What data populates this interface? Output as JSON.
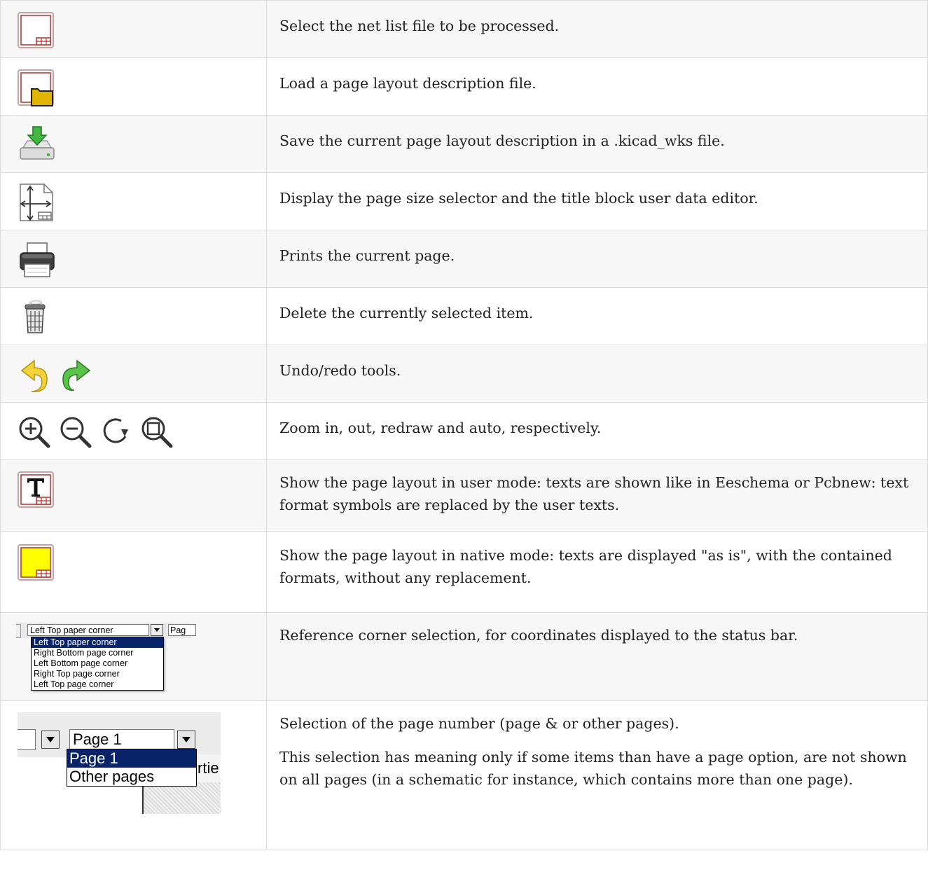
{
  "rows": [
    {
      "icon": "netlist-file-icon",
      "text": "Select the net list file to be processed."
    },
    {
      "icon": "load-layout-folder-icon",
      "text": "Load a page layout description file."
    },
    {
      "icon": "save-drive-icon",
      "text": "Save the current page layout description in a .kicad_wks file."
    },
    {
      "icon": "page-size-icon",
      "text": "Display the page size selector and the title block user data editor."
    },
    {
      "icon": "printer-icon",
      "text": "Prints the current page."
    },
    {
      "icon": "trash-icon",
      "text": "Delete the currently selected item."
    },
    {
      "icon": "undo-redo-icons",
      "text": "Undo/redo tools."
    },
    {
      "icon": "zoom-icons",
      "text": "Zoom in, out, redraw and auto, respectively."
    },
    {
      "icon": "user-mode-icon",
      "text": "Show the page layout in user mode: texts are shown like in Eeschema or Pcbnew: text format symbols are replaced by the user texts."
    },
    {
      "icon": "native-mode-icon",
      "text": "Show the page layout in native mode: texts are displayed \"as is\", with the contained formats, without any replacement."
    },
    {
      "icon": "reference-corner-dropdown",
      "text": "Reference corner selection, for coordinates displayed to the status bar."
    },
    {
      "icon": "page-number-dropdown",
      "text": "Selection of the page number (page & or other pages).",
      "text2": "This selection has meaning only if some items than have a page option, are not shown on all pages (in a schematic for instance, which contains more than one page)."
    }
  ],
  "corner_dropdown": {
    "selected": "Left Top paper corner",
    "next_field": "Pag",
    "options": [
      "Left Top paper corner",
      "Right Bottom page corner",
      "Left Bottom page corner",
      "Right Top page corner",
      "Left Top page corner"
    ]
  },
  "page_dropdown": {
    "selected": "Page 1",
    "side_tab": "rtie",
    "options": [
      "Page 1",
      "Other pages"
    ]
  },
  "colors": {
    "row_alt_bg": "#f7f7f7",
    "border": "#dcdcdc",
    "selection_bg": "#0a246a",
    "yellow": "#ffff00",
    "folder": "#e2b500"
  }
}
